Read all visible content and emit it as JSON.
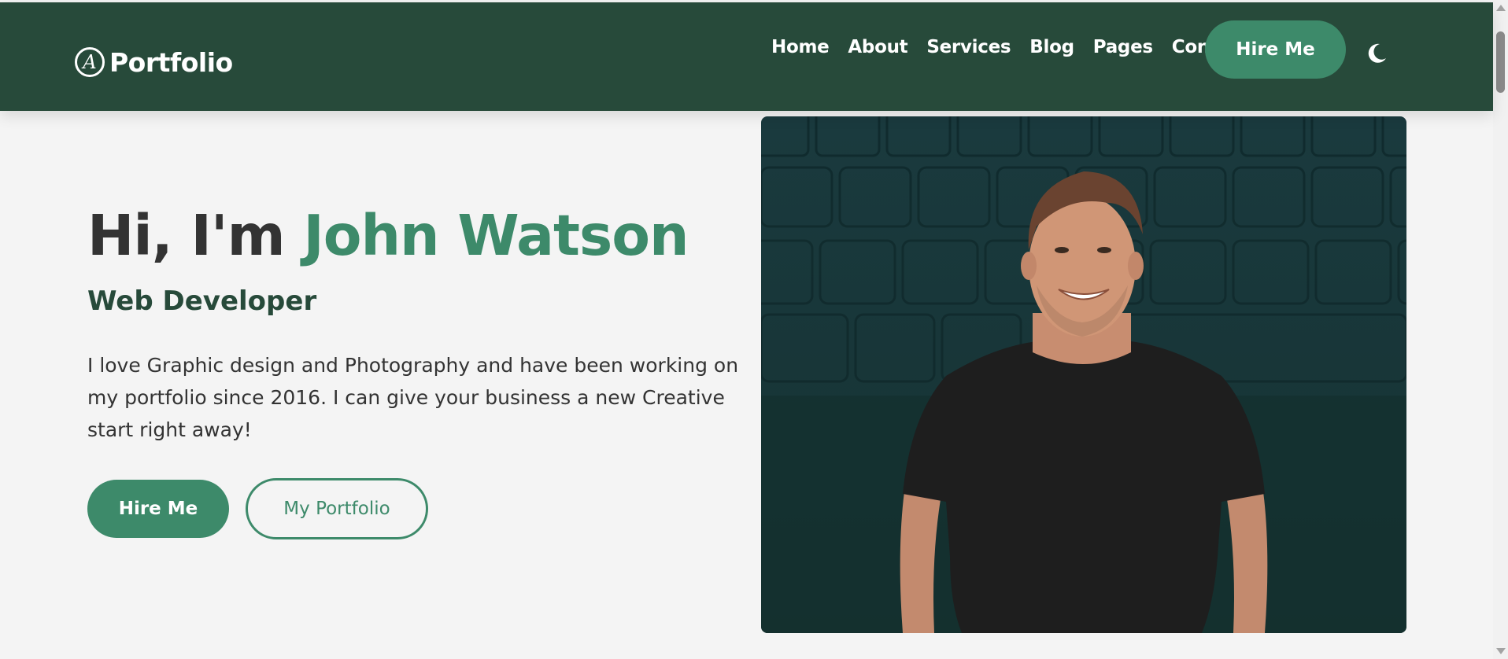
{
  "colors": {
    "nav_bg": "#274a3a",
    "accent": "#3d8a6a",
    "page_bg": "#f4f4f4",
    "text_dark": "#333333"
  },
  "header": {
    "logo_mark": "A",
    "logo_text": "Portfolio",
    "nav": [
      {
        "label": "Home"
      },
      {
        "label": "About"
      },
      {
        "label": "Services"
      },
      {
        "label": "Blog"
      },
      {
        "label": "Pages"
      },
      {
        "label": "Contact"
      }
    ],
    "hire_button": "Hire Me",
    "theme_toggle_icon": "moon-icon"
  },
  "hero": {
    "greeting": "Hi, I'm ",
    "name": "John Watson",
    "role": "Web Developer",
    "description": "I love Graphic design and Photography and have been working on my portfolio since 2016. I can give your business a new Creative start right away!",
    "primary_button": "Hire Me",
    "secondary_button": "My Portfolio"
  }
}
